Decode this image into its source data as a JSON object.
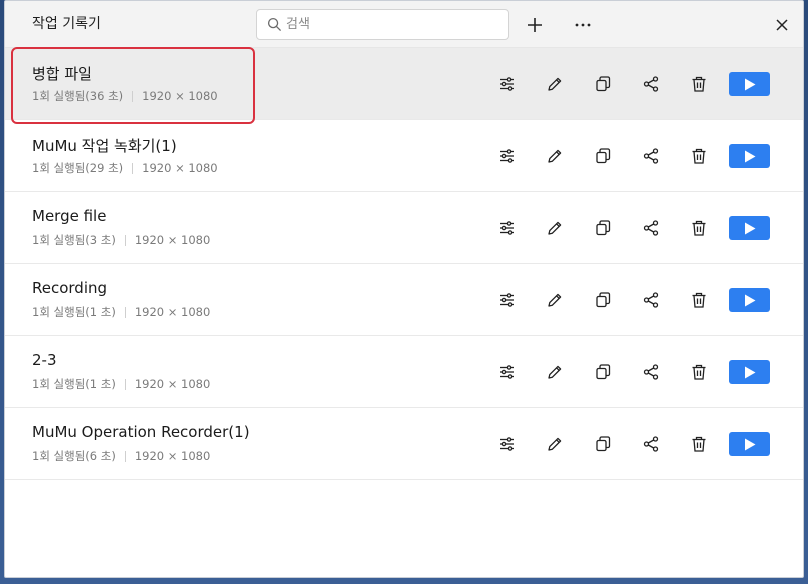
{
  "window": {
    "title": "작업 기록기",
    "search_placeholder": "검색"
  },
  "toolbar": {
    "add_icon": "plus-icon",
    "more_icon": "more-horizontal-icon",
    "close_icon": "close-icon"
  },
  "accent_color": "#2d7ff0",
  "selection_outline_color": "#d9313f",
  "selected_index": 0,
  "recordings": [
    {
      "title": "병합 파일",
      "runs": "1회 실행됨(36 초)",
      "resolution": "1920 × 1080"
    },
    {
      "title": "MuMu 작업 녹화기(1)",
      "runs": "1회 실행됨(29 초)",
      "resolution": "1920 × 1080"
    },
    {
      "title": "Merge file",
      "runs": "1회 실행됨(3 초)",
      "resolution": "1920 × 1080"
    },
    {
      "title": "Recording",
      "runs": "1회 실행됨(1 초)",
      "resolution": "1920 × 1080"
    },
    {
      "title": "2-3",
      "runs": "1회 실행됨(1 초)",
      "resolution": "1920 × 1080"
    },
    {
      "title": "MuMu Operation Recorder(1)",
      "runs": "1회 실행됨(6 초)",
      "resolution": "1920 × 1080"
    }
  ],
  "row_actions": [
    "settings-sliders-icon",
    "pencil-icon",
    "copy-icon",
    "share-icon",
    "trash-icon",
    "play-icon"
  ]
}
